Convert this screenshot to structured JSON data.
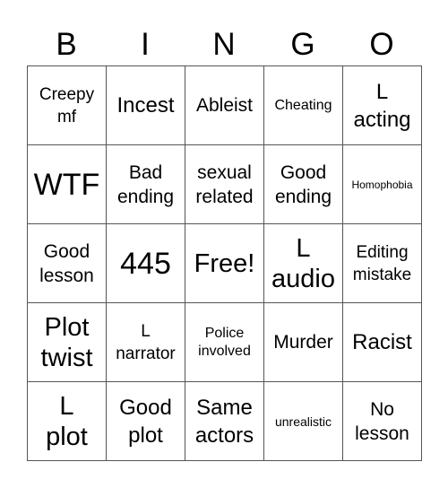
{
  "header": {
    "letters": [
      "B",
      "I",
      "N",
      "G",
      "O"
    ]
  },
  "grid": {
    "rows": [
      [
        "Creepy\nmf",
        "Incest",
        "Ableist",
        "Cheating",
        "L\nacting"
      ],
      [
        "WTF",
        "Bad\nending",
        "sexual\nrelated",
        "Good\nending",
        "Homophobia"
      ],
      [
        "Good\nlesson",
        "445",
        "Free!",
        "L\naudio",
        "Editing\nmistake"
      ],
      [
        "Plot\ntwist",
        "L\nnarrator",
        "Police\ninvolved",
        "Murder",
        "Racist"
      ],
      [
        "L\nplot",
        "Good\nplot",
        "Same\nactors",
        "unrealistic",
        "No\nlesson"
      ]
    ]
  }
}
